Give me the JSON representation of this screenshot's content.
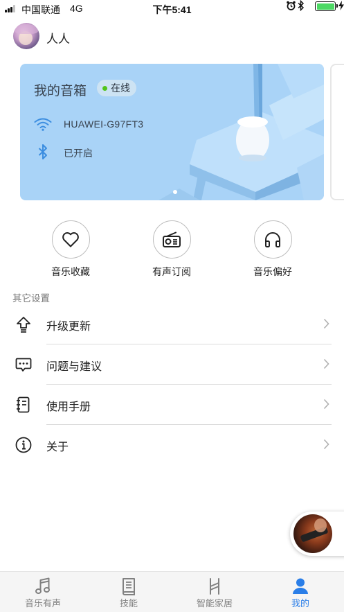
{
  "status_bar": {
    "carrier": "中国联通",
    "network": "4G",
    "time": "下午5:41",
    "battery_level": 1.0,
    "icons": [
      "signal-icon",
      "alarm-icon",
      "bluetooth-icon",
      "battery-icon",
      "charging-icon"
    ]
  },
  "header": {
    "user_name": "人人"
  },
  "speaker_card": {
    "title": "我的音箱",
    "status": "在线",
    "status_color": "#52c41a",
    "wifi_name": "HUAWEI-G97FT3",
    "bluetooth_status": "已开启",
    "card_color": "#a9d3f7",
    "page_index": 1,
    "page_count": 2
  },
  "quick_actions": [
    {
      "label": "音乐收藏",
      "icon": "heart-icon"
    },
    {
      "label": "有声订阅",
      "icon": "radio-icon"
    },
    {
      "label": "音乐偏好",
      "icon": "headphones-icon"
    }
  ],
  "settings": {
    "section_title": "其它设置",
    "items": [
      {
        "label": "升级更新",
        "icon": "upgrade-icon"
      },
      {
        "label": "问题与建议",
        "icon": "feedback-icon"
      },
      {
        "label": "使用手册",
        "icon": "manual-icon"
      },
      {
        "label": "关于",
        "icon": "info-icon"
      }
    ]
  },
  "tab_bar": {
    "accent_color": "#2a7ee8",
    "tabs": [
      {
        "label": "音乐有声",
        "icon": "music-note-icon",
        "active": false
      },
      {
        "label": "技能",
        "icon": "book-icon",
        "active": false
      },
      {
        "label": "智能家居",
        "icon": "smart-home-icon",
        "active": false
      },
      {
        "label": "我的",
        "icon": "person-icon",
        "active": true
      }
    ]
  }
}
